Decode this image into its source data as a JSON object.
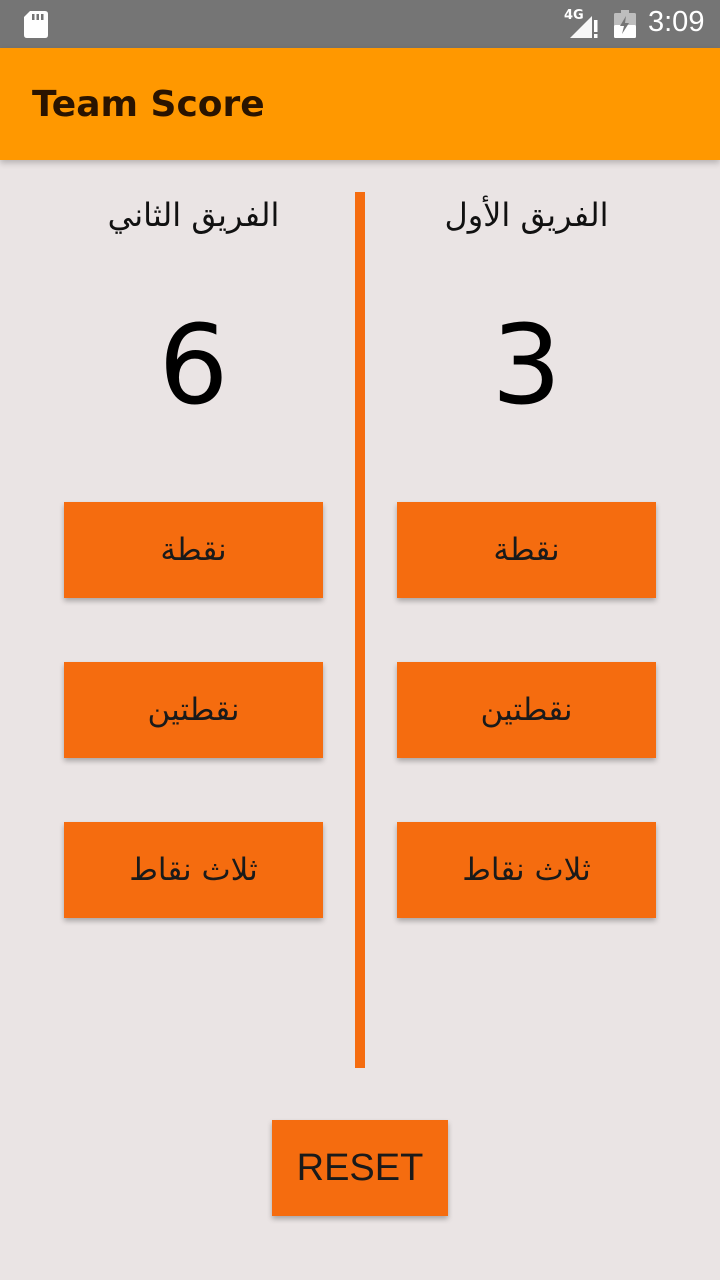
{
  "status_bar": {
    "network_label": "4G",
    "time": "3:09",
    "icons": [
      "sd-card-icon",
      "signal-icon",
      "battery-icon"
    ]
  },
  "app_bar": {
    "title": "Team Score"
  },
  "team_one": {
    "name": "الفريق الأول",
    "score": "3",
    "buttons": {
      "one_point": "نقطة",
      "two_points": "نقطتين",
      "three_points": "ثلاث نقاط"
    }
  },
  "team_two": {
    "name": "الفريق الثاني",
    "score": "6",
    "buttons": {
      "one_point": "نقطة",
      "two_points": "نقطتين",
      "three_points": "ثلاث نقاط"
    }
  },
  "reset_label": "RESET",
  "colors": {
    "app_bar": "#FF9800",
    "button": "#F56C0F",
    "background": "#EAE4E4",
    "status_bar": "#757575"
  }
}
